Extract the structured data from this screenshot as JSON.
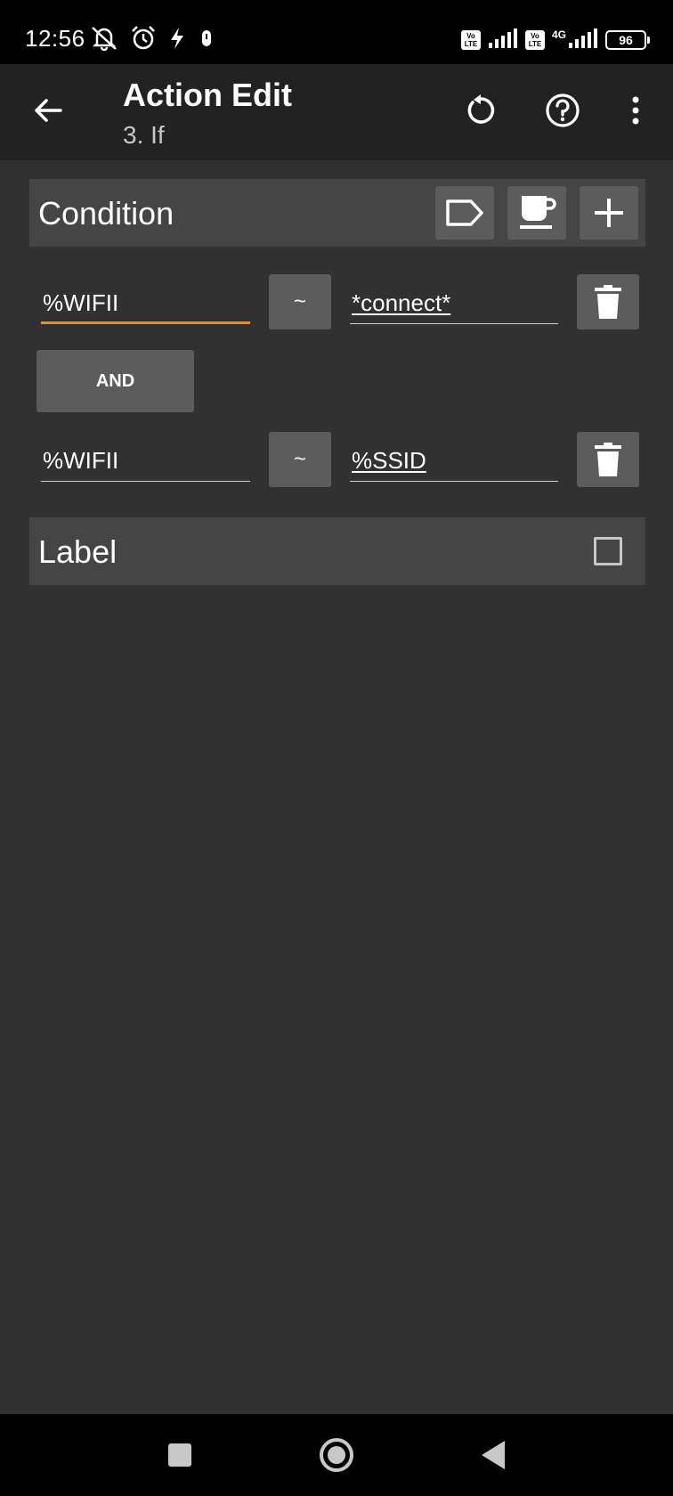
{
  "status_bar": {
    "time": "12:56",
    "left_icons": [
      "bell-off-icon",
      "alarm-icon",
      "flash-icon",
      "notification-icon"
    ],
    "volte_label": "Vo LTE",
    "network_label": "4G",
    "battery_level": "96"
  },
  "header": {
    "title": "Action Edit",
    "subtitle": "3. If",
    "icons": [
      "back-arrow-icon",
      "undo-icon",
      "help-icon",
      "more-vert-icon"
    ]
  },
  "condition_section": {
    "title": "Condition",
    "buttons": [
      "tag-icon",
      "coffee-icon",
      "plus-icon"
    ],
    "rows": [
      {
        "left": "%WIFII",
        "operator": "~",
        "right": "*connect*"
      },
      {
        "left": "%WIFII",
        "operator": "~",
        "right": "%SSID"
      }
    ],
    "joiner": "AND"
  },
  "label_section": {
    "title": "Label",
    "checked": false
  },
  "nav_bar": {
    "buttons": [
      "recents-icon",
      "home-icon",
      "back-icon"
    ]
  },
  "colors": {
    "background": "#313131",
    "app_bar": "#222222",
    "section_header": "#454545",
    "button": "#5c5c5c",
    "accent": "#f08a24"
  }
}
